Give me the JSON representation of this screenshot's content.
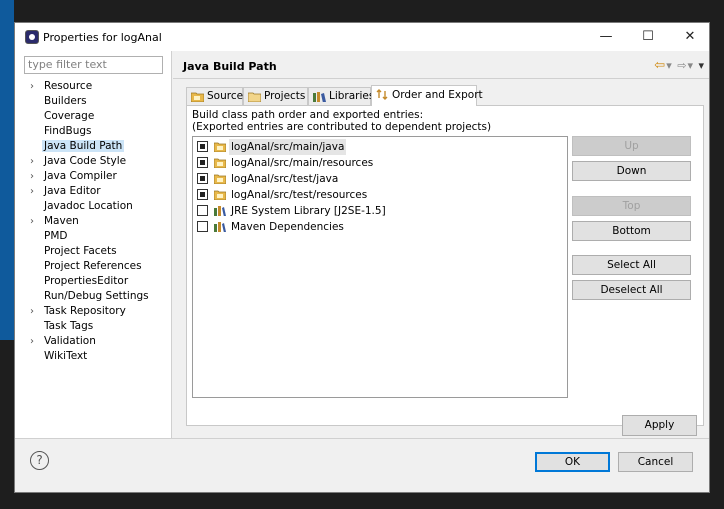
{
  "window": {
    "title": "Properties for logAnal",
    "controls": {
      "minimize": "—",
      "maximize": "☐",
      "close": "✕"
    }
  },
  "filter": {
    "placeholder": "type filter text"
  },
  "tree": [
    {
      "label": "Resource",
      "expandable": true
    },
    {
      "label": "Builders",
      "expandable": false
    },
    {
      "label": "Coverage",
      "expandable": false
    },
    {
      "label": "FindBugs",
      "expandable": false
    },
    {
      "label": "Java Build Path",
      "expandable": false,
      "selected": true
    },
    {
      "label": "Java Code Style",
      "expandable": true
    },
    {
      "label": "Java Compiler",
      "expandable": true
    },
    {
      "label": "Java Editor",
      "expandable": true
    },
    {
      "label": "Javadoc Location",
      "expandable": false
    },
    {
      "label": "Maven",
      "expandable": true
    },
    {
      "label": "PMD",
      "expandable": false
    },
    {
      "label": "Project Facets",
      "expandable": false
    },
    {
      "label": "Project References",
      "expandable": false
    },
    {
      "label": "PropertiesEditor",
      "expandable": false
    },
    {
      "label": "Run/Debug Settings",
      "expandable": false
    },
    {
      "label": "Task Repository",
      "expandable": true
    },
    {
      "label": "Task Tags",
      "expandable": false
    },
    {
      "label": "Validation",
      "expandable": true
    },
    {
      "label": "WikiText",
      "expandable": false
    }
  ],
  "page": {
    "title": "Java Build Path",
    "tabs": [
      "Source",
      "Projects",
      "Libraries",
      "Order and Export"
    ],
    "active_tab": "Order and Export",
    "description_line1": "Build class path order and exported entries:",
    "description_line2": "(Exported entries are contributed to dependent projects)",
    "entries": [
      {
        "label": "logAnal/src/main/java",
        "checked": true,
        "kind": "source-folder",
        "selected": true
      },
      {
        "label": "logAnal/src/main/resources",
        "checked": true,
        "kind": "source-folder"
      },
      {
        "label": "logAnal/src/test/java",
        "checked": true,
        "kind": "source-folder"
      },
      {
        "label": "logAnal/src/test/resources",
        "checked": true,
        "kind": "source-folder"
      },
      {
        "label": "JRE System Library [J2SE-1.5]",
        "checked": false,
        "kind": "library"
      },
      {
        "label": "Maven Dependencies",
        "checked": false,
        "kind": "library"
      }
    ],
    "buttons": {
      "up": "Up",
      "down": "Down",
      "top": "Top",
      "bottom": "Bottom",
      "select_all": "Select All",
      "deselect_all": "Deselect All"
    },
    "apply": "Apply"
  },
  "footer": {
    "help": "?",
    "ok": "OK",
    "cancel": "Cancel"
  },
  "colors": {
    "selection": "#cce4f7",
    "accent": "#0078d7",
    "folder": "#e8b84a"
  }
}
